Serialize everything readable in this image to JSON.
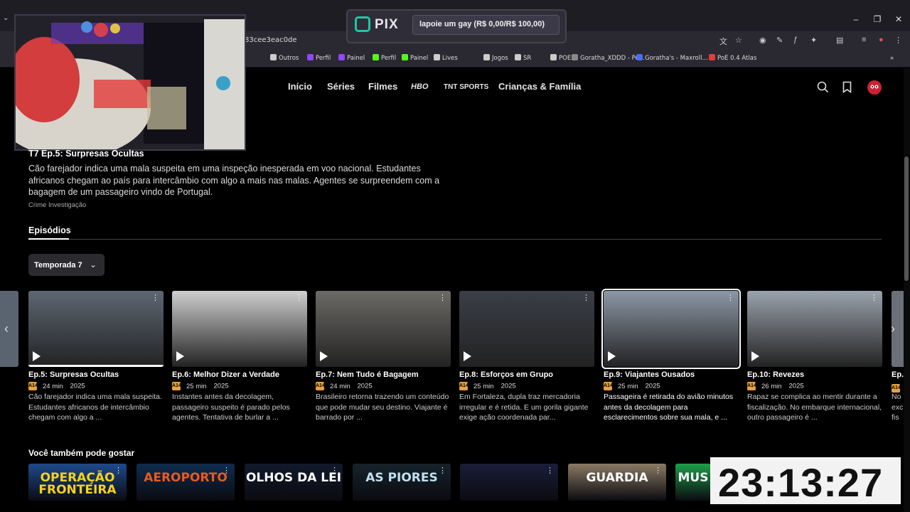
{
  "browser": {
    "url_fragment": "83cee3eac0de",
    "bookmarks": [
      {
        "label": "Outros",
        "color": "#cccccc"
      },
      {
        "label": "Perfil",
        "color": "#9146ff"
      },
      {
        "label": "Painel",
        "color": "#9146ff"
      },
      {
        "label": "Perfil",
        "color": "#53fc18"
      },
      {
        "label": "Painel",
        "color": "#53fc18"
      },
      {
        "label": "Lives",
        "color": "#cccccc"
      },
      {
        "label": "Jogos",
        "color": "#cccccc"
      },
      {
        "label": "SR",
        "color": "#cccccc"
      },
      {
        "label": "POE2",
        "color": "#cccccc"
      },
      {
        "label": "Goratha_XDDD - Po...",
        "color": "#888888"
      },
      {
        "label": "Goratha's - Maxroll...",
        "color": "#4a6cff"
      },
      {
        "label": "PoE 0.4 Atlas",
        "color": "#e23b3b"
      }
    ]
  },
  "pix": {
    "logo": "PIX",
    "text": "lapoie um gay (R$ 0,00/R$ 100,00)"
  },
  "nav": {
    "items": [
      "Início",
      "Séries",
      "Filmes",
      "HBO",
      "TNT SPORTS",
      "Crianças & Família"
    ]
  },
  "episode": {
    "heading": "T7 Ep.5: Surpresas Ocultas",
    "description": "Cão farejador indica uma mala suspeita em uma inspeção inesperada em voo nacional. Estudantes africanos chegam ao país para intercâmbio com algo a mais nas malas. Agentes se surpreendem com a bagagem de um passageiro vindo de Portugal.",
    "genres": "Crime  Investigação"
  },
  "tabs": {
    "episodes": "Episódios"
  },
  "season": {
    "selected": "Temporada 7"
  },
  "rating_label": "A14",
  "cards": [
    {
      "title": "Ep.5: Surpresas Ocultas",
      "duration": "24 min",
      "year": "2025",
      "desc": "Cão farejador indica uma mala suspeita. Estudantes africanos de intercâmbio  chegam com algo a ...",
      "color": "#5d6774",
      "progress": 1.0
    },
    {
      "title": "Ep.6: Melhor Dizer a Verdade",
      "duration": "25 min",
      "year": "2025",
      "desc": "Instantes antes da decolagem, passageiro suspeito é parado pelos agentes. Tentativa de burlar a ...",
      "color": "#cfcfcf",
      "progress": 0
    },
    {
      "title": "Ep.7: Nem Tudo é Bagagem",
      "duration": "24 min",
      "year": "2025",
      "desc": "Brasileiro retorna trazendo um conteúdo que pode mudar seu destino. Viajante é barrado por ...",
      "color": "#6c6a66",
      "progress": 0
    },
    {
      "title": "Ep.8: Esforços em Grupo",
      "duration": "25 min",
      "year": "2025",
      "desc": "Em Fortaleza, dupla traz mercadoria irregular e é retida. E um gorila gigante exige ação coordenada par...",
      "color": "#3a3e46",
      "progress": 0
    },
    {
      "title": "Ep.9: Viajantes Ousados",
      "duration": "25 min",
      "year": "2025",
      "desc": "Passageira é retirada do avião minutos antes da decolagem para esclarecimentos sobre sua mala, e ...",
      "color": "#8d98a6",
      "progress": 0,
      "selected": true
    },
    {
      "title": "Ep.10: Revezes",
      "duration": "26 min",
      "year": "2025",
      "desc": "Rapaz se complica ao mentir durante a fiscalização. No embarque internacional, outro passageiro é ...",
      "color": "#9aa3ad",
      "progress": 0
    }
  ],
  "edge_card": {
    "title": "Ep.",
    "desc": "No exc fis"
  },
  "recs": {
    "heading": "Você também pode gostar",
    "items": [
      {
        "label": "OPERAÇÃO FRONTEIRA",
        "bg": "#1d4a8a",
        "fg": "#f5d21a"
      },
      {
        "label": "AEROPORTO",
        "bg": "#0f2c4f",
        "fg": "#e85a1f"
      },
      {
        "label": "OLHOS DA LEI",
        "bg": "#101a2c",
        "fg": "#ffffff"
      },
      {
        "label": "AS PIORES",
        "bg": "#16232c",
        "fg": "#bfe0ef"
      },
      {
        "label": "",
        "bg": "#1a1e3a",
        "fg": "#ffffff"
      },
      {
        "label": "GUARDIA",
        "bg": "#8a7a64",
        "fg": "#ffffff"
      },
      {
        "label": "MUS",
        "bg": "#1e9e4a",
        "fg": "#ffffff"
      }
    ]
  },
  "clock": "23:13:27"
}
